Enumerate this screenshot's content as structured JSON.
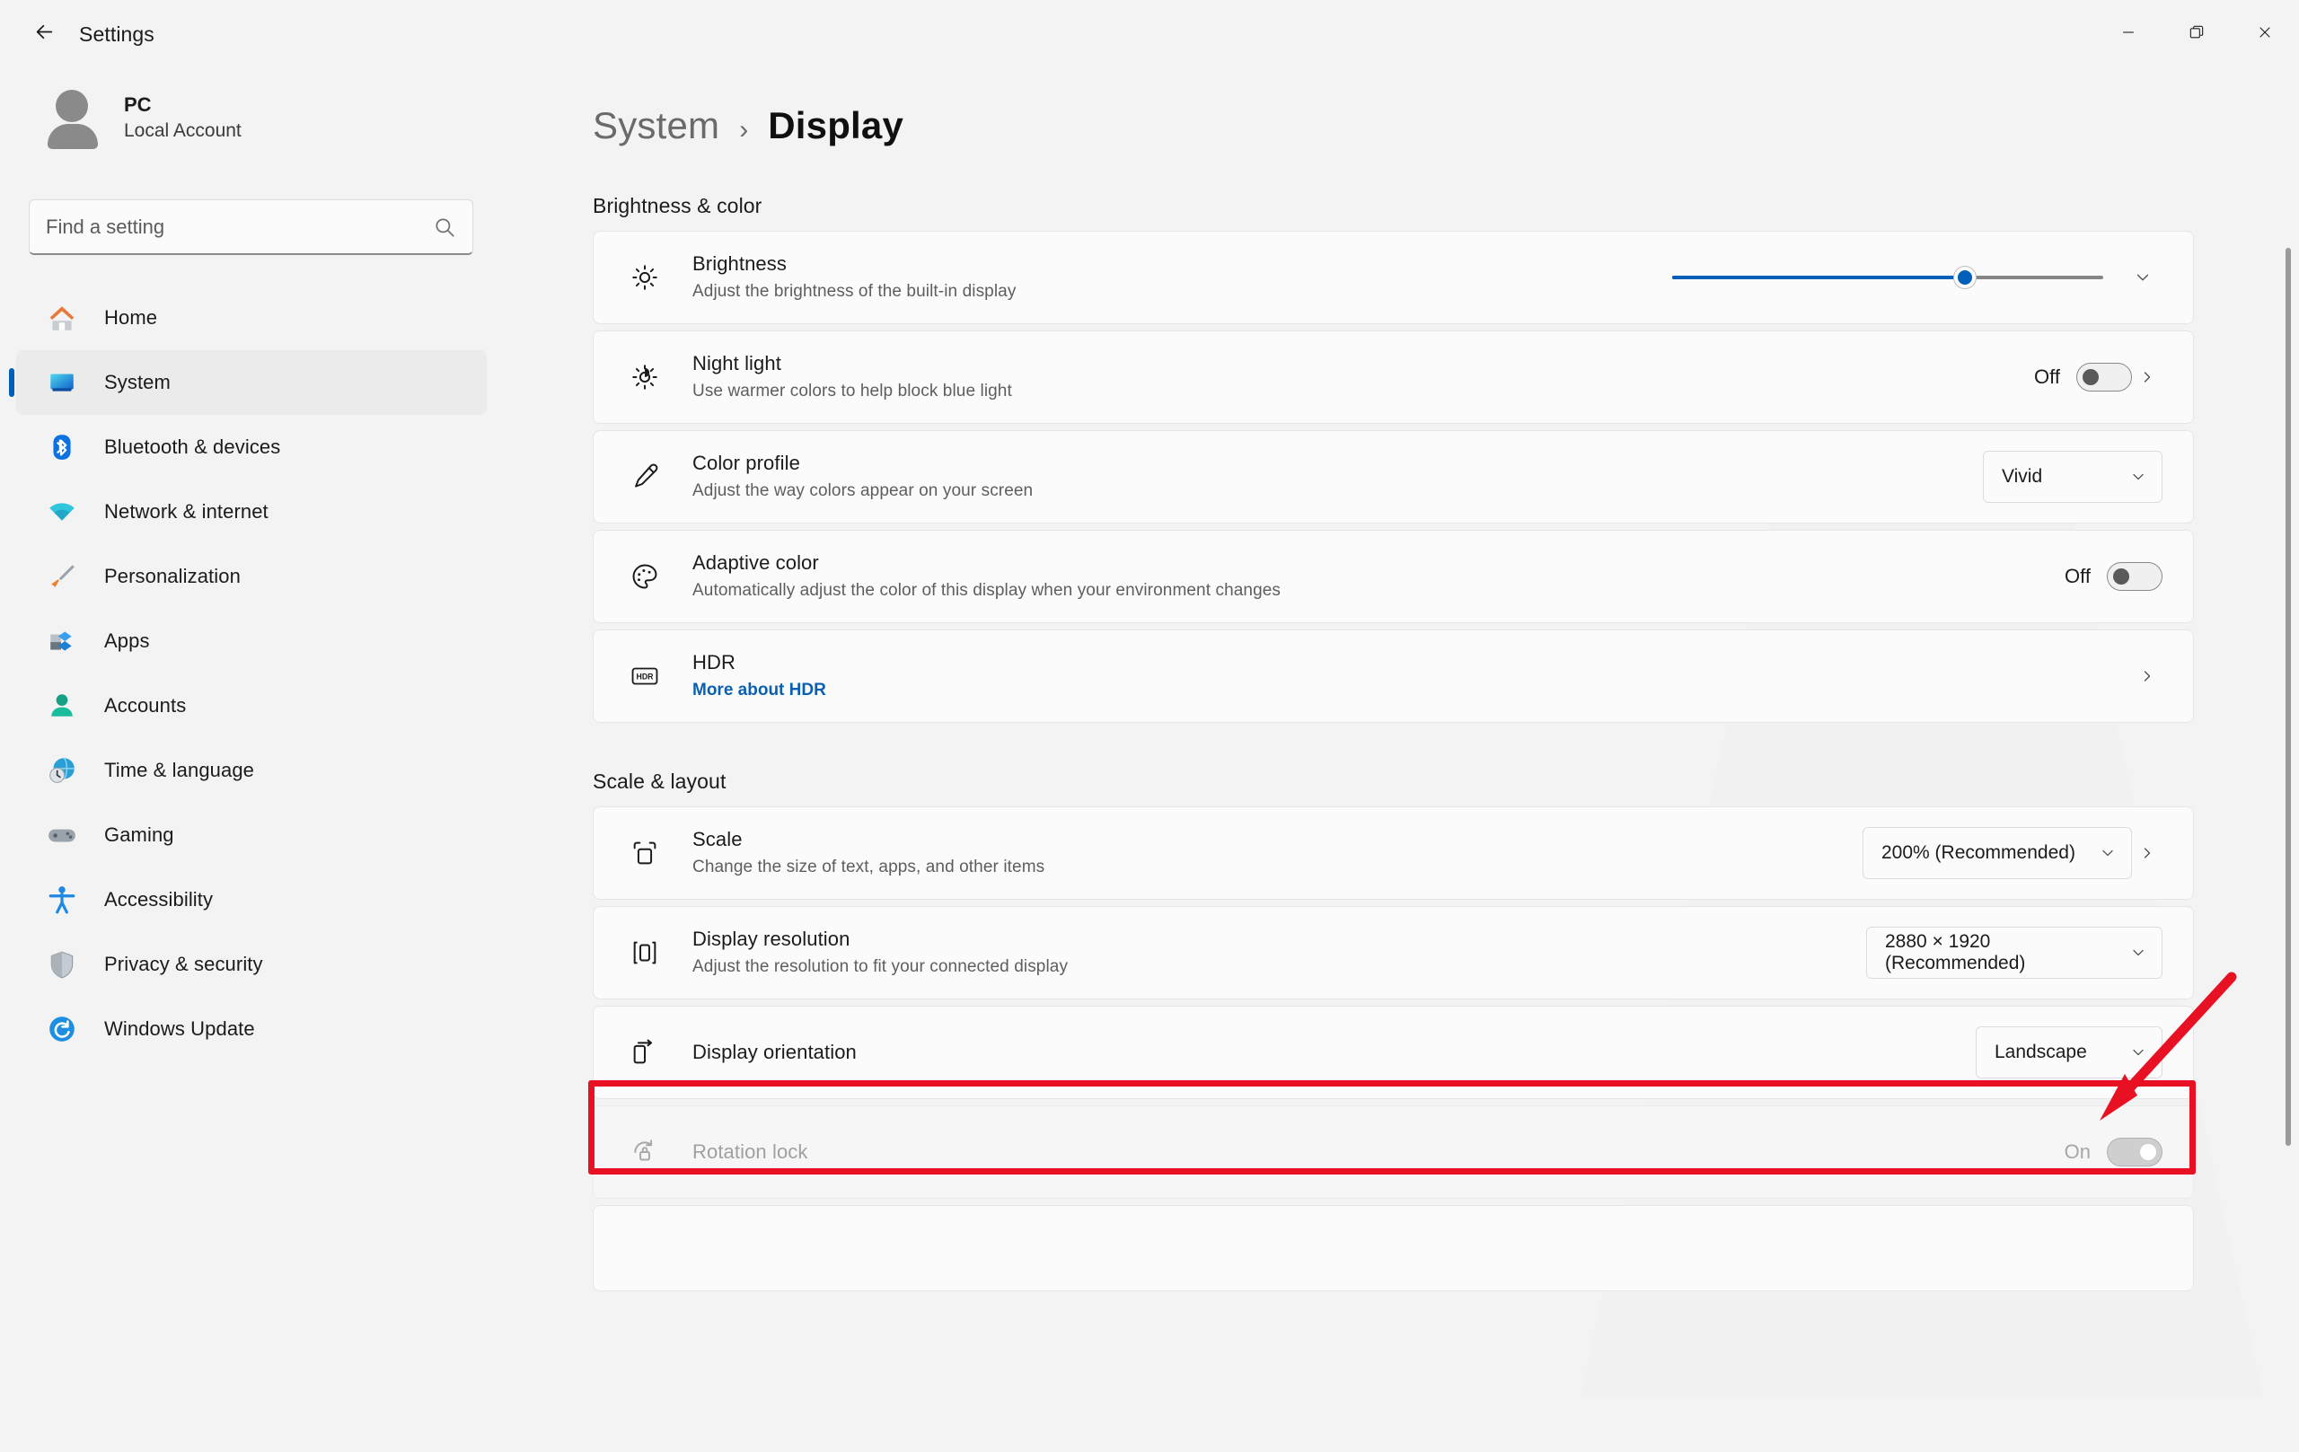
{
  "window": {
    "app_title": "Settings",
    "back_icon": "back-arrow-icon",
    "minimize_label": "Minimize",
    "maximize_label": "Restore",
    "close_label": "Close"
  },
  "sidebar": {
    "account": {
      "name": "PC",
      "subtitle": "Local Account"
    },
    "search": {
      "placeholder": "Find a setting",
      "value": ""
    },
    "items": [
      {
        "label": "Home",
        "icon": "home-icon",
        "selected": false
      },
      {
        "label": "System",
        "icon": "system-icon",
        "selected": true
      },
      {
        "label": "Bluetooth & devices",
        "icon": "bluetooth-icon",
        "selected": false
      },
      {
        "label": "Network & internet",
        "icon": "network-icon",
        "selected": false
      },
      {
        "label": "Personalization",
        "icon": "personalization-icon",
        "selected": false
      },
      {
        "label": "Apps",
        "icon": "apps-icon",
        "selected": false
      },
      {
        "label": "Accounts",
        "icon": "accounts-icon",
        "selected": false
      },
      {
        "label": "Time & language",
        "icon": "time-language-icon",
        "selected": false
      },
      {
        "label": "Gaming",
        "icon": "gaming-icon",
        "selected": false
      },
      {
        "label": "Accessibility",
        "icon": "accessibility-icon",
        "selected": false
      },
      {
        "label": "Privacy & security",
        "icon": "privacy-security-icon",
        "selected": false
      },
      {
        "label": "Windows Update",
        "icon": "windows-update-icon",
        "selected": false
      }
    ]
  },
  "breadcrumb": {
    "parent": "System",
    "separator": "›",
    "current": "Display"
  },
  "sections": [
    {
      "heading": "Brightness & color"
    },
    {
      "heading": "Scale & layout"
    }
  ],
  "rows": {
    "brightness": {
      "title": "Brightness",
      "subtitle": "Adjust the brightness of the built-in display",
      "icon": "brightness-icon",
      "slider_percent": 68
    },
    "night_light": {
      "title": "Night light",
      "subtitle": "Use warmer colors to help block blue light",
      "icon": "night-light-icon",
      "state": "Off"
    },
    "color_profile": {
      "title": "Color profile",
      "subtitle": "Adjust the way colors appear on your screen",
      "icon": "color-profile-icon",
      "value": "Vivid"
    },
    "adaptive_color": {
      "title": "Adaptive color",
      "subtitle": "Automatically adjust the color of this display when your environment changes",
      "icon": "adaptive-color-icon",
      "state": "Off"
    },
    "hdr": {
      "title": "HDR",
      "link": "More about HDR",
      "icon": "hdr-icon"
    },
    "scale": {
      "title": "Scale",
      "subtitle": "Change the size of text, apps, and other items",
      "icon": "scale-icon",
      "value": "200% (Recommended)"
    },
    "display_resolution": {
      "title": "Display resolution",
      "subtitle": "Adjust the resolution to fit your connected display",
      "icon": "display-resolution-icon",
      "value": "2880 × 1920 (Recommended)",
      "highlighted": true
    },
    "display_orientation": {
      "title": "Display orientation",
      "icon": "display-orientation-icon",
      "value": "Landscape"
    },
    "rotation_lock": {
      "title": "Rotation lock",
      "icon": "rotation-lock-icon",
      "state": "On",
      "disabled": true
    }
  },
  "annotation": {
    "color": "#e81123",
    "target": "display-resolution-row"
  },
  "colors": {
    "accent": "#005fb8",
    "link": "#0b5fb0",
    "page_bg": "#f3f3f3",
    "card_bg": "#fbfbfb"
  }
}
